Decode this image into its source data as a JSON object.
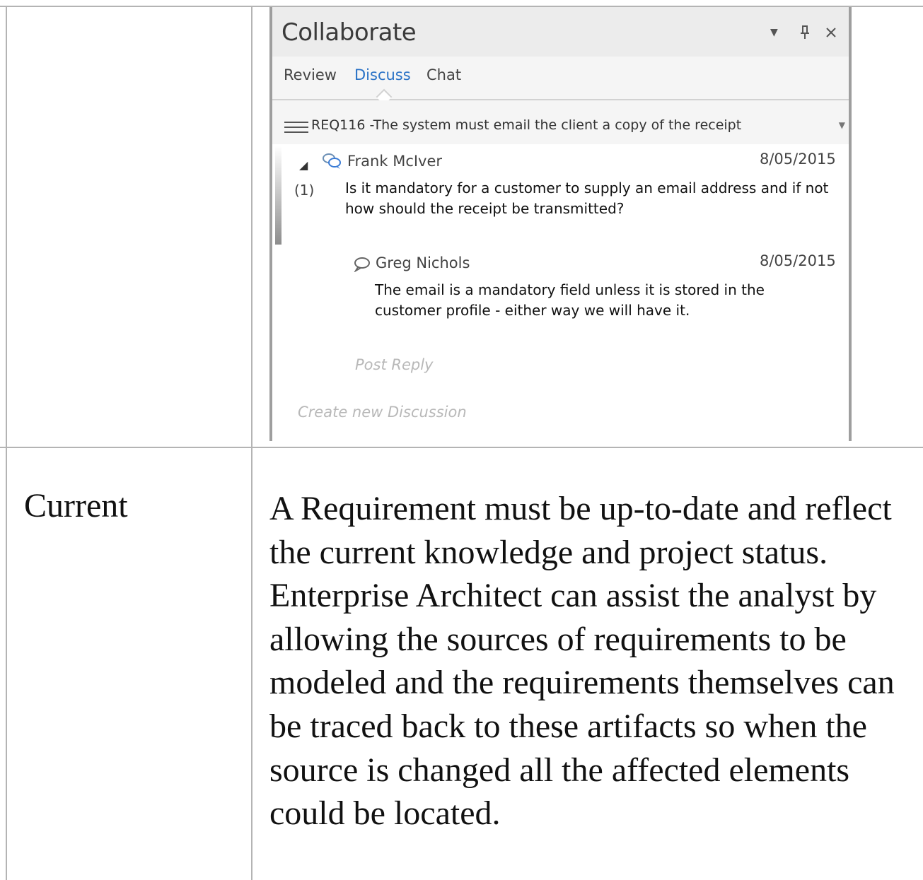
{
  "panel": {
    "title": "Collaborate",
    "header_icons": [
      "chevron-down-icon",
      "pin-icon",
      "close-icon"
    ],
    "tabs": [
      {
        "label": "Review",
        "active": false
      },
      {
        "label": "Discuss",
        "active": true
      },
      {
        "label": "Chat",
        "active": false
      }
    ],
    "selected_item": "REQ116 -The system must email the client a copy of the receipt",
    "discussion": {
      "author": "Frank McIver",
      "date": "8/05/2015",
      "reply_count": "(1)",
      "message": "Is it mandatory for a customer to supply an email address and if not how should the receipt be transmitted?"
    },
    "reply": {
      "author": "Greg Nichols",
      "date": "8/05/2015",
      "message": "The email is a  mandatory field unless it is stored in the customer  profile - either way we will have it."
    },
    "post_reply_label": "Post Reply",
    "create_discussion_label": "Create new Discussion"
  },
  "row": {
    "label": "Current",
    "text": "A Requirement must be up-to-date and reflect the current knowledge and project status. Enterprise Architect can assist the analyst by allowing the sources of requirements to be modeled and the requirements themselves can be traced back to these artifacts so when the source is changed all the affected elements could be located."
  },
  "colors": {
    "accent": "#2a72c6",
    "border": "#b4b4b4",
    "placeholder": "#b8b8b8"
  }
}
